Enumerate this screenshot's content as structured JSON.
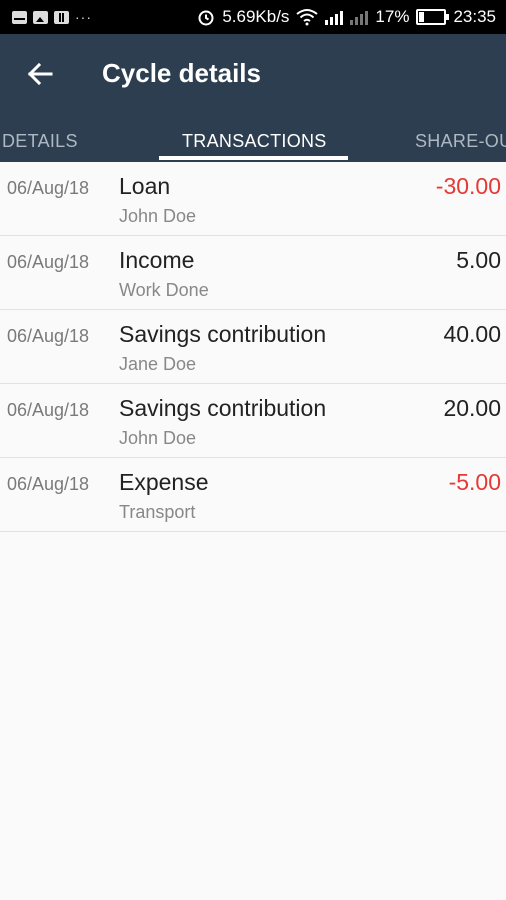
{
  "status_bar": {
    "speed": "5.69Kb/s",
    "battery": "17%",
    "battery_level": 0.17,
    "time": "23:35",
    "notification_icons": [
      "mail-icon",
      "image-icon",
      "document-icon"
    ],
    "more": "···"
  },
  "appbar": {
    "title": "Cycle details",
    "background": "#2c3e50"
  },
  "tabs": [
    {
      "label": "DETAILS",
      "active": false
    },
    {
      "label": "TRANSACTIONS",
      "active": true
    },
    {
      "label": "SHARE-OU",
      "active": false
    }
  ],
  "transactions": [
    {
      "date": "06/Aug/18",
      "title": "Loan",
      "subtitle": "John Doe",
      "amount": "-30.00",
      "negative": true
    },
    {
      "date": "06/Aug/18",
      "title": "Income",
      "subtitle": "Work Done",
      "amount": "5.00",
      "negative": false
    },
    {
      "date": "06/Aug/18",
      "title": "Savings contribution",
      "subtitle": "Jane Doe",
      "amount": "40.00",
      "negative": false
    },
    {
      "date": "06/Aug/18",
      "title": "Savings contribution",
      "subtitle": "John Doe",
      "amount": "20.00",
      "negative": false
    },
    {
      "date": "06/Aug/18",
      "title": "Expense",
      "subtitle": "Transport",
      "amount": "-5.00",
      "negative": true
    }
  ],
  "colors": {
    "negative_amount": "#e53935",
    "tab_inactive": "#aeb8c3"
  }
}
